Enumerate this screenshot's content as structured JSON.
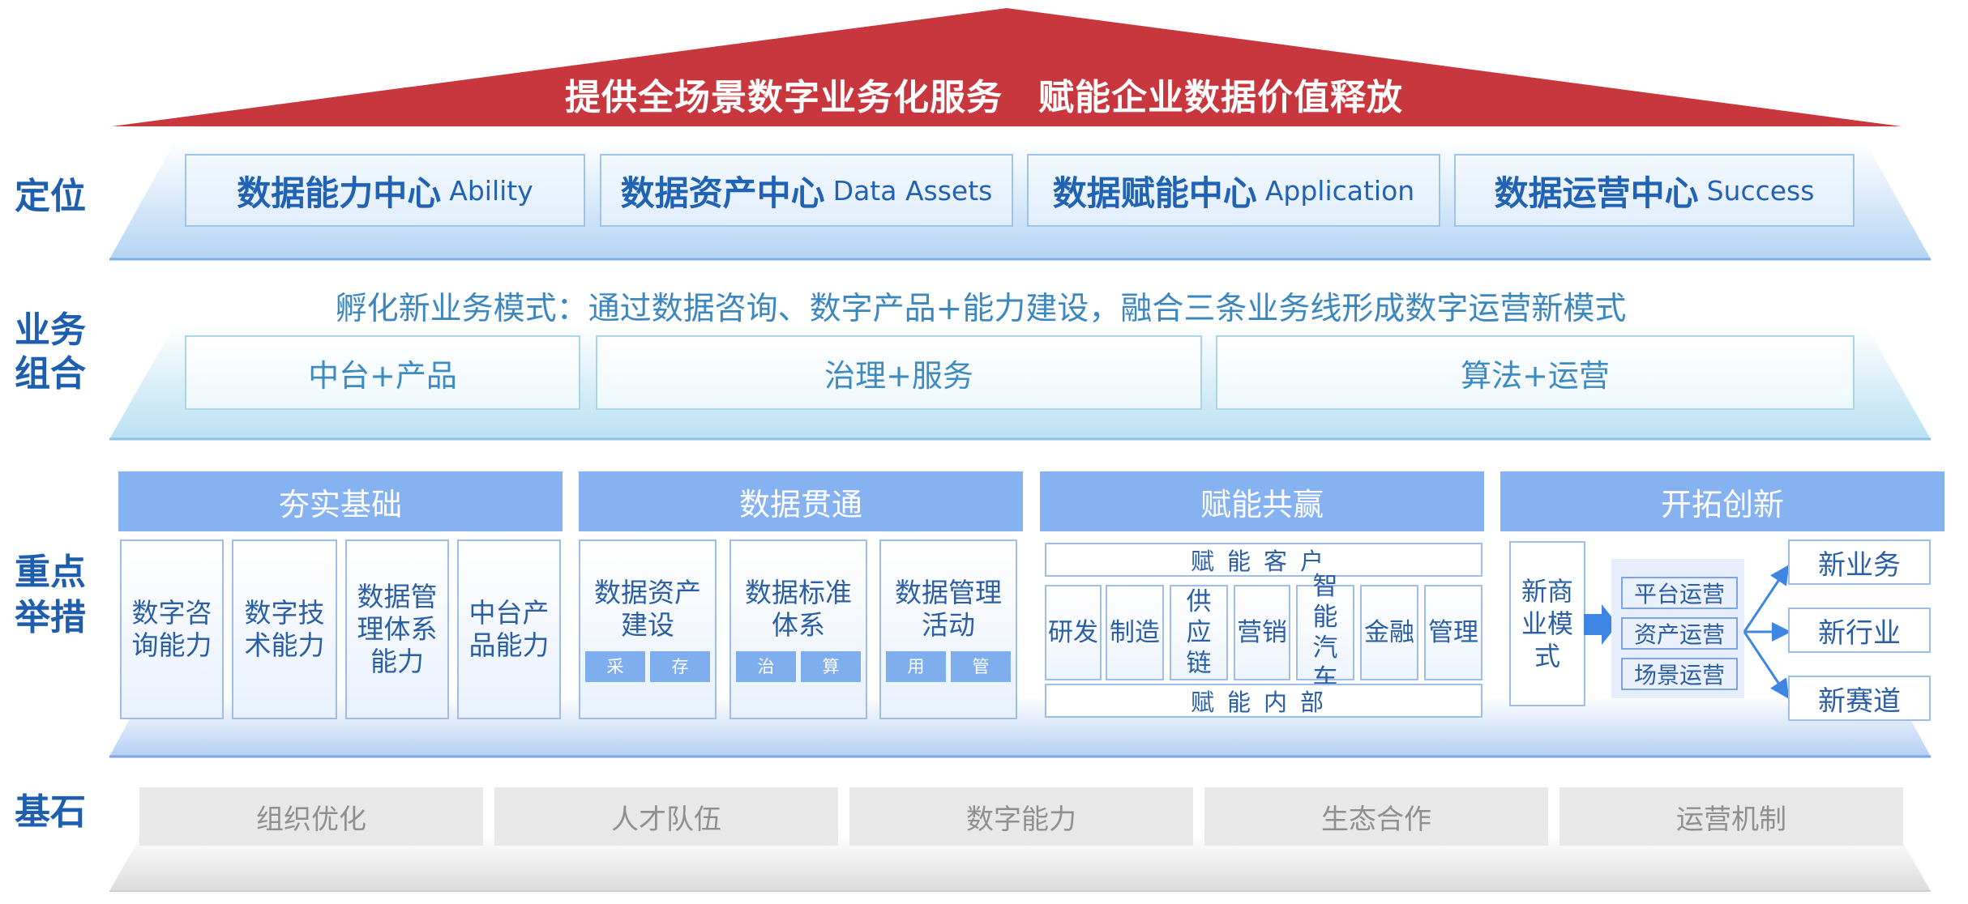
{
  "roof": {
    "text_left": "提供全场景数字业务化服务",
    "text_right": "赋能企业数据价值释放"
  },
  "labels": {
    "positioning": "定位",
    "business_1": "业务",
    "business_2": "组合",
    "measures_1": "重点",
    "measures_2": "举措",
    "cornerstone": "基石"
  },
  "positioning": [
    {
      "cn": "数据能力中心",
      "en": "Ability"
    },
    {
      "cn": "数据资产中心",
      "en": "Data Assets"
    },
    {
      "cn": "数据赋能中心",
      "en": "Application"
    },
    {
      "cn": "数据运营中心",
      "en": "Success"
    }
  ],
  "business": {
    "banner": "孵化新业务模式：通过数据咨询、数字产品+能力建设，融合三条业务线形成数字运营新模式",
    "lines": [
      "中台+产品",
      "治理+服务",
      "算法+运营"
    ]
  },
  "measures": {
    "categories": [
      "夯实基础",
      "数据贯通",
      "赋能共赢",
      "开拓创新"
    ],
    "foundation": [
      "数字咨询能力",
      "数字技术能力",
      "数据管理体系能力",
      "中台产品能力"
    ],
    "integration": [
      {
        "name": "数据资产建设",
        "tags": [
          "采",
          "存"
        ]
      },
      {
        "name": "数据标准体系",
        "tags": [
          "治",
          "算"
        ]
      },
      {
        "name": "数据管理活动",
        "tags": [
          "用",
          "管"
        ]
      }
    ],
    "empower": {
      "top": "赋能客户",
      "bottom": "赋能内部",
      "industries": [
        "研发",
        "制造",
        "供应链",
        "营销",
        "智能汽车",
        "金融",
        "管理"
      ]
    },
    "innovate": {
      "model": "新商业模式",
      "ops": [
        "平台运营",
        "资产运营",
        "场景运营"
      ],
      "outcomes": [
        "新业务",
        "新行业",
        "新赛道"
      ]
    }
  },
  "cornerstone": [
    "组织优化",
    "人才队伍",
    "数字能力",
    "生态合作",
    "运营机制"
  ],
  "colors": {
    "roof": "#c8363e",
    "primary_text": "#1d5fae",
    "header_blue": "#86b2f2",
    "arrow": "#3f86e4"
  }
}
